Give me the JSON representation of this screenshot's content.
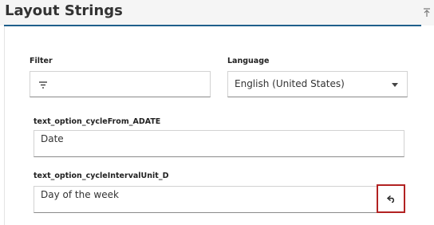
{
  "header": {
    "title": "Layout Strings",
    "collapse_icon": "collapse-up-icon"
  },
  "filter": {
    "label": "Filter",
    "value": "",
    "icon": "filter-icon"
  },
  "language": {
    "label": "Language",
    "selected": "English (United States)",
    "icon": "chevron-down-icon"
  },
  "strings": [
    {
      "key": "text_option_cycleFrom_ADATE",
      "value": "Date"
    },
    {
      "key": "text_option_cycleIntervalUnit_D",
      "value": "Day of the week",
      "action_icon": "undo-icon"
    }
  ],
  "colors": {
    "accent": "#1f5f8b",
    "highlight": "#b22222"
  }
}
